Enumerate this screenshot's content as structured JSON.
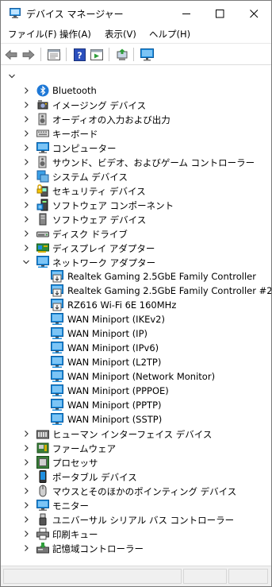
{
  "window": {
    "title": "デバイス マネージャー"
  },
  "menu": {
    "items": [
      {
        "label": "ファイル(F)"
      },
      {
        "label": "操作(A)"
      },
      {
        "label": "表示(V)"
      },
      {
        "label": "ヘルプ(H)"
      }
    ]
  },
  "toolbar": {
    "icons": [
      "back-arrow-icon",
      "forward-arrow-icon",
      "properties-icon",
      "help-icon",
      "run-icon",
      "update-driver-icon",
      "monitor-icon"
    ]
  },
  "tree": {
    "categories": [
      {
        "label": "Bluetooth",
        "icon": "bluetooth-icon"
      },
      {
        "label": "イメージング デバイス",
        "icon": "camera-icon"
      },
      {
        "label": "オーディオの入力および出力",
        "icon": "speaker-icon"
      },
      {
        "label": "キーボード",
        "icon": "keyboard-icon"
      },
      {
        "label": "コンピューター",
        "icon": "computer-icon"
      },
      {
        "label": "サウンド、ビデオ、およびゲーム コントローラー",
        "icon": "speaker-icon"
      },
      {
        "label": "システム デバイス",
        "icon": "system-device-icon"
      },
      {
        "label": "セキュリティ デバイス",
        "icon": "security-device-icon"
      },
      {
        "label": "ソフトウェア コンポーネント",
        "icon": "software-component-icon"
      },
      {
        "label": "ソフトウェア デバイス",
        "icon": "software-device-icon"
      },
      {
        "label": "ディスク ドライブ",
        "icon": "disk-drive-icon"
      },
      {
        "label": "ディスプレイ アダプター",
        "icon": "display-adapter-icon"
      },
      {
        "label": "ネットワーク アダプター",
        "icon": "network-adapter-icon",
        "expanded": true
      }
    ],
    "network_adapters": [
      {
        "label": "Realtek Gaming 2.5GbE Family Controller",
        "icon": "network-card-icon"
      },
      {
        "label": "Realtek Gaming 2.5GbE Family Controller #2",
        "icon": "network-card-icon"
      },
      {
        "label": "RZ616 Wi-Fi 6E 160MHz",
        "icon": "network-card-icon"
      },
      {
        "label": "WAN Miniport (IKEv2)",
        "icon": "network-adapter-icon"
      },
      {
        "label": "WAN Miniport (IP)",
        "icon": "network-adapter-icon"
      },
      {
        "label": "WAN Miniport (IPv6)",
        "icon": "network-adapter-icon"
      },
      {
        "label": "WAN Miniport (L2TP)",
        "icon": "network-adapter-icon"
      },
      {
        "label": "WAN Miniport (Network Monitor)",
        "icon": "network-adapter-icon"
      },
      {
        "label": "WAN Miniport (PPPOE)",
        "icon": "network-adapter-icon"
      },
      {
        "label": "WAN Miniport (PPTP)",
        "icon": "network-adapter-icon"
      },
      {
        "label": "WAN Miniport (SSTP)",
        "icon": "network-adapter-icon"
      }
    ],
    "categories_after": [
      {
        "label": "ヒューマン インターフェイス デバイス",
        "icon": "hid-icon"
      },
      {
        "label": "ファームウェア",
        "icon": "firmware-icon"
      },
      {
        "label": "プロセッサ",
        "icon": "processor-icon"
      },
      {
        "label": "ポータブル デバイス",
        "icon": "portable-device-icon"
      },
      {
        "label": "マウスとそのほかのポインティング デバイス",
        "icon": "mouse-icon"
      },
      {
        "label": "モニター",
        "icon": "monitor-icon"
      },
      {
        "label": "ユニバーサル シリアル バス コントローラー",
        "icon": "usb-icon"
      },
      {
        "label": "印刷キュー",
        "icon": "printer-icon"
      },
      {
        "label": "記憶域コントローラー",
        "icon": "storage-controller-icon"
      }
    ]
  },
  "colors": {
    "accent": "#0078d7",
    "monitor_blue": "#1e8fe0"
  }
}
